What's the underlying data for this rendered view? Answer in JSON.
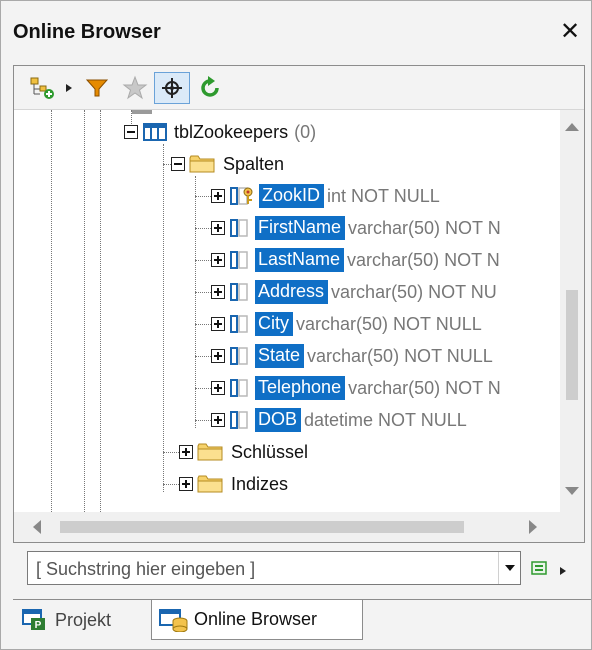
{
  "window": {
    "title": "Online Browser",
    "close_glyph": "✕"
  },
  "toolbar": {
    "buttons": [
      {
        "name": "add-object-icon",
        "active": false
      },
      {
        "name": "expand-arrow-icon",
        "active": false
      },
      {
        "name": "filter-icon",
        "active": false
      },
      {
        "name": "favorites-star-icon",
        "active": false
      },
      {
        "name": "object-locator-icon",
        "active": true
      },
      {
        "name": "refresh-icon",
        "active": false
      }
    ]
  },
  "tree": {
    "table": {
      "name": "tblZookeepers",
      "count": "(0)"
    },
    "columns_folder": "Spalten",
    "columns": [
      {
        "name": "ZookID",
        "type": "int NOT NULL",
        "key": true
      },
      {
        "name": "FirstName",
        "type": "varchar(50) NOT N"
      },
      {
        "name": "LastName",
        "type": "varchar(50) NOT N"
      },
      {
        "name": "Address",
        "type": "varchar(50) NOT NU"
      },
      {
        "name": "City",
        "type": "varchar(50) NOT NULL"
      },
      {
        "name": "State",
        "type": "varchar(50) NOT NULL"
      },
      {
        "name": "Telephone",
        "type": "varchar(50) NOT N"
      },
      {
        "name": "DOB",
        "type": "datetime NOT NULL"
      }
    ],
    "keys_folder": "Schlüssel",
    "indexes_folder": "Indizes"
  },
  "search": {
    "placeholder": "[ Suchstring hier eingeben ]"
  },
  "tabs": [
    {
      "label": "Projekt",
      "active": false
    },
    {
      "label": "Online Browser",
      "active": true
    }
  ],
  "colors": {
    "selection": "#0f6fc6",
    "accent_green": "#2e9a2e",
    "filter_orange": "#e58a00"
  }
}
